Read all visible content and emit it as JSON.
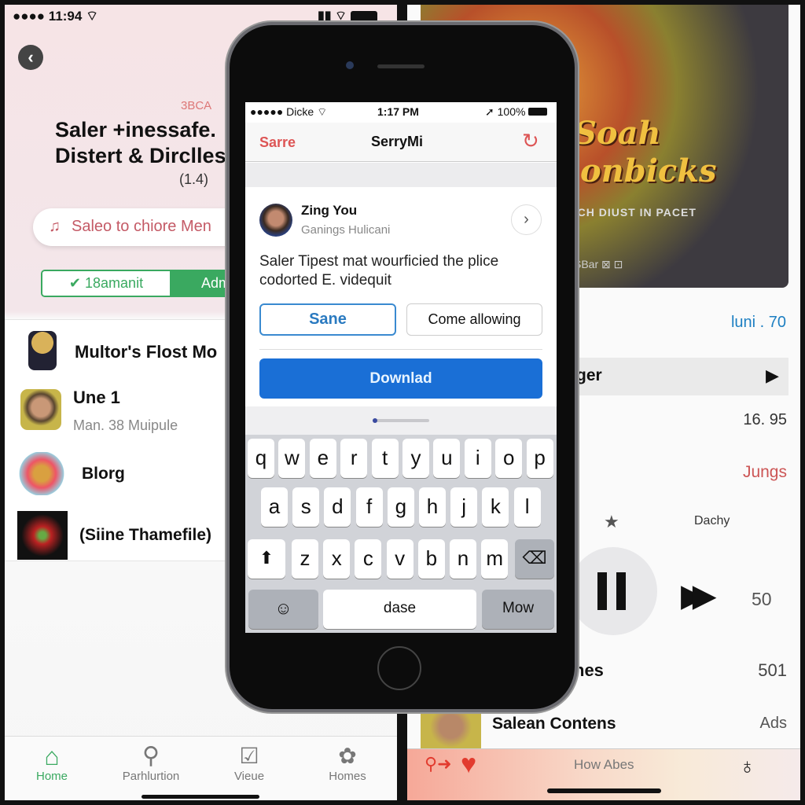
{
  "left_app": {
    "status": {
      "time": "11:94"
    },
    "subtitle": "3BCA",
    "title_line1": "Saler +inessafe.",
    "title_line2": "Distert & Dirclles",
    "version": "(1.4)",
    "search_pill": "Saleo to chiore Men",
    "segment": {
      "left": "18amanit",
      "right": "Adm"
    },
    "list": [
      {
        "title": "Multor's Flost Mo"
      },
      {
        "title": "Une 1",
        "subtitle": "Man. 38 Muipule"
      },
      {
        "title": "Blorg"
      },
      {
        "title": "(Siine Thamefile)"
      }
    ],
    "tabs": [
      {
        "label": "Home",
        "icon": "home-icon"
      },
      {
        "label": "Parhlurtion",
        "icon": "search-icon"
      },
      {
        "label": "Vieue",
        "icon": "inbox-icon"
      },
      {
        "label": "Homes",
        "icon": "flower-icon"
      }
    ],
    "accent": "#3aa960"
  },
  "right_app": {
    "album_text": {
      "line1": "Soah",
      "line2": "Shonbicks",
      "tagline": "ATCH DIUST IN PACET",
      "caption": "SBar"
    },
    "date": "luni . 70",
    "now_row": "ger",
    "price": "16. 95",
    "link": "Jungs",
    "rating_label": "Dachy",
    "count": "50",
    "row_nes": {
      "label": "nes",
      "value": "501"
    },
    "row_contents": {
      "label": "Salean Contens",
      "value": "Ads"
    },
    "tab_center": "How Abes",
    "accent": "#e23b2e"
  },
  "phone": {
    "status": {
      "carrier": "Dicke",
      "time": "1:17 PM",
      "battery": "100%"
    },
    "nav": {
      "left": "Sarre",
      "title": "SerryMi"
    },
    "card": {
      "name": "Zing You",
      "handle": "Ganings Hulicani",
      "body": "Saler Tipest mat wourficied the plice codorted E. videquit"
    },
    "buttons": {
      "primary_outline": "Sane",
      "secondary": "Come allowing",
      "download": "Downlad"
    },
    "keyboard": {
      "row1": [
        "q",
        "w",
        "e",
        "r",
        "t",
        "y",
        "u",
        "i",
        "o",
        "p"
      ],
      "row2": [
        "a",
        "s",
        "d",
        "f",
        "g",
        "h",
        "j",
        "k",
        "l"
      ],
      "row3": [
        "z",
        "x",
        "c",
        "v",
        "b",
        "n",
        "m"
      ],
      "space": "dase",
      "return": "Mow"
    },
    "blue": "#1a6fd6"
  }
}
